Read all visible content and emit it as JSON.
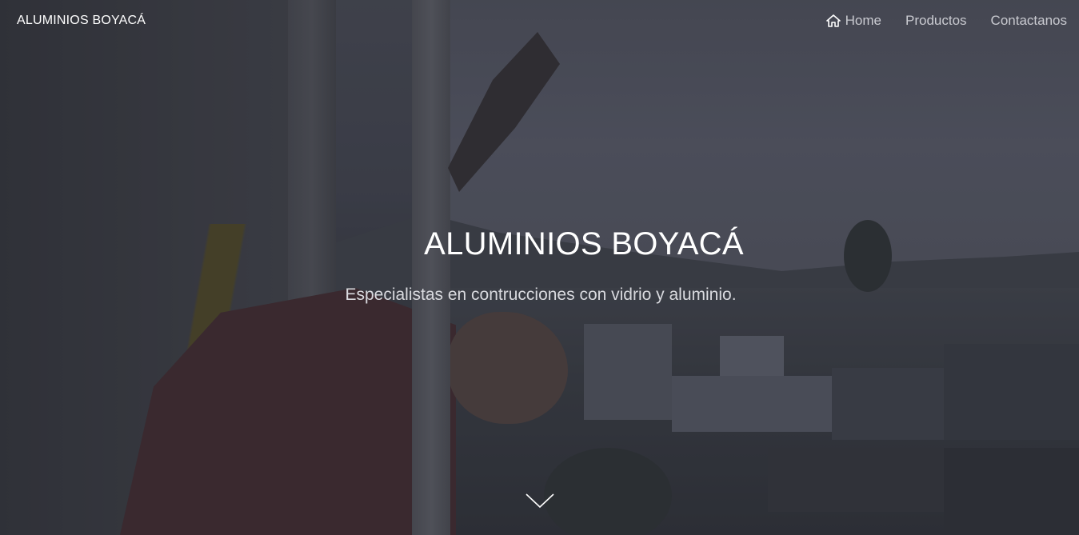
{
  "navbar": {
    "brand": "ALUMINIOS BOYACÁ",
    "links": [
      {
        "label": "Home",
        "icon": "home-icon"
      },
      {
        "label": "Productos"
      },
      {
        "label": "Contactanos"
      }
    ]
  },
  "hero": {
    "title": "ALUMINIOS BOYACÁ",
    "subtitle": "Especialistas en contrucciones con vidrio y aluminio.",
    "scroll_icon": "chevron-down-icon"
  },
  "colors": {
    "text_primary": "#ffffff",
    "nav_link": "#c9cad0",
    "overlay": "#1e1f28"
  }
}
